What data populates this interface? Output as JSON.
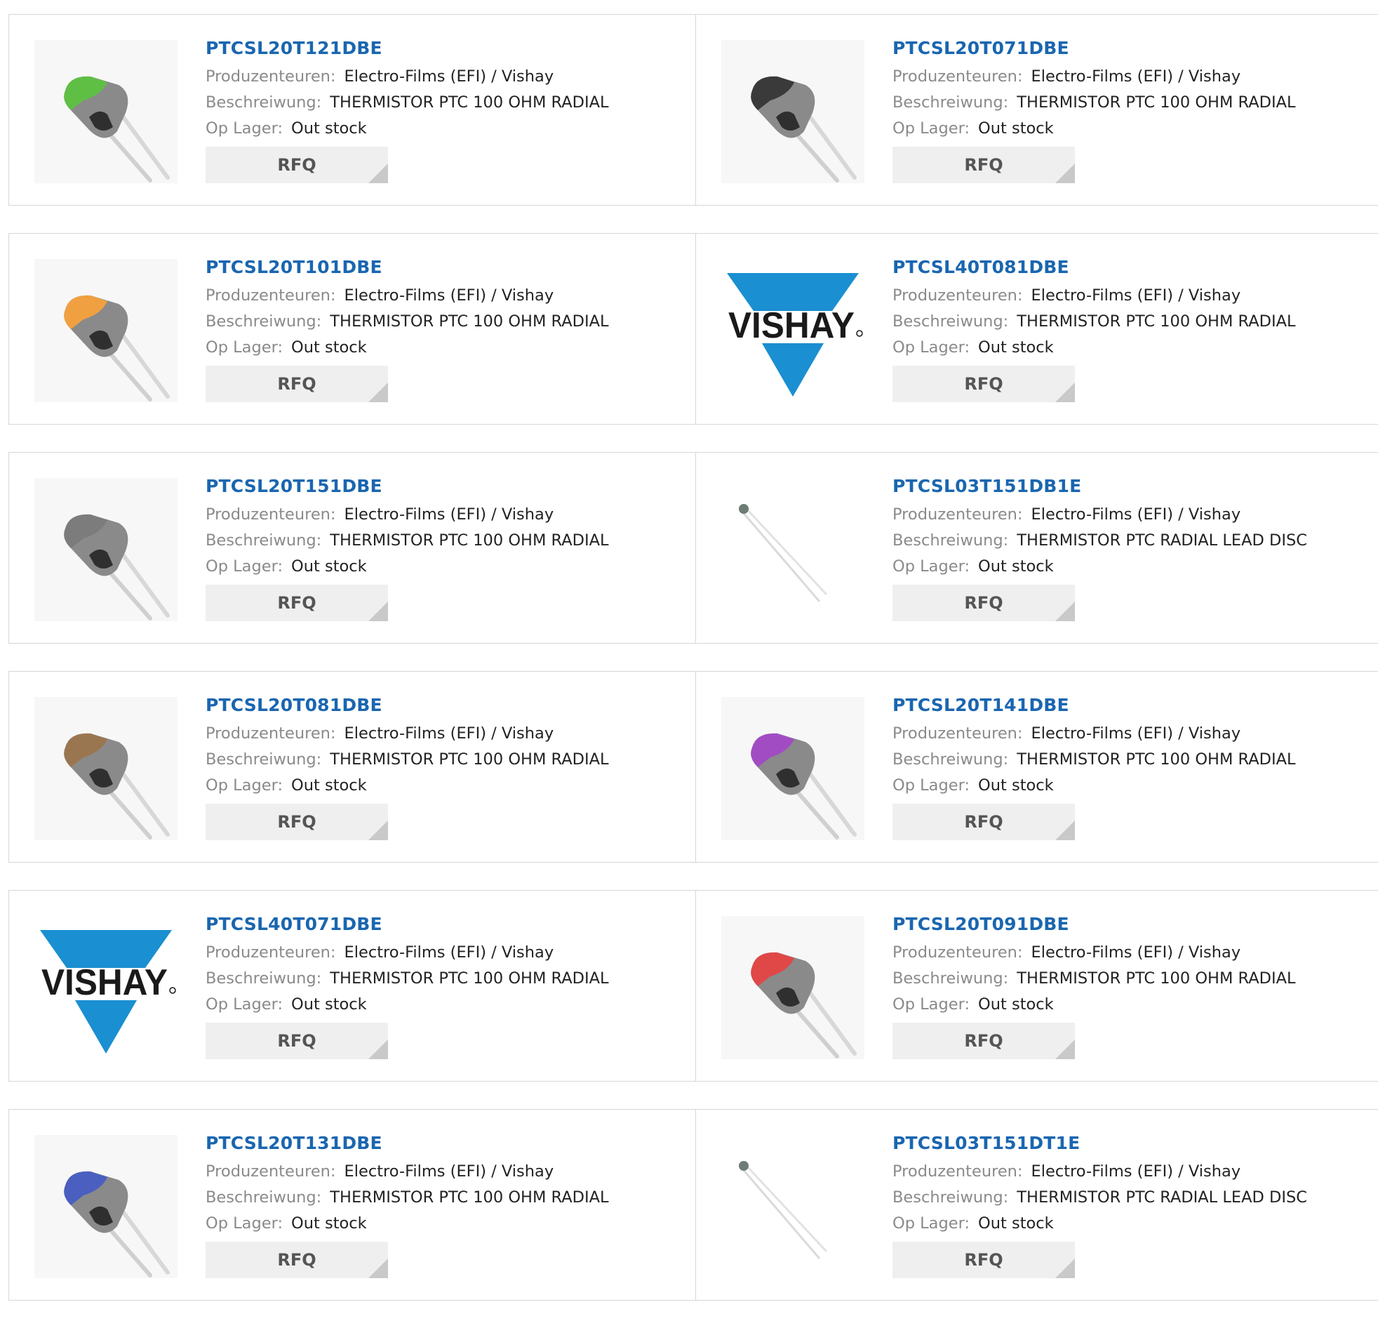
{
  "labels": {
    "manufacturer": "Produzenteuren:",
    "description": "Beschreiwung:",
    "stock": "Op Lager:",
    "rfq": "RFQ"
  },
  "products": [
    {
      "part": "PTCSL20T121DBE",
      "manufacturer": "Electro-Films (EFI) / Vishay",
      "description": "THERMISTOR PTC 100 OHM RADIAL",
      "stock": "Out stock",
      "image": "thermistor-green-icon",
      "cap_color": "#5fbf45"
    },
    {
      "part": "PTCSL20T071DBE",
      "manufacturer": "Electro-Films (EFI) / Vishay",
      "description": "THERMISTOR PTC 100 OHM RADIAL",
      "stock": "Out stock",
      "image": "thermistor-black-icon",
      "cap_color": "#3a3a3a"
    },
    {
      "part": "PTCSL20T101DBE",
      "manufacturer": "Electro-Films (EFI) / Vishay",
      "description": "THERMISTOR PTC 100 OHM RADIAL",
      "stock": "Out stock",
      "image": "thermistor-orange-icon",
      "cap_color": "#f0a040"
    },
    {
      "part": "PTCSL40T081DBE",
      "manufacturer": "Electro-Films (EFI) / Vishay",
      "description": "THERMISTOR PTC 100 OHM RADIAL",
      "stock": "Out stock",
      "image": "vishay-logo",
      "logo_text": "VISHAY"
    },
    {
      "part": "PTCSL20T151DBE",
      "manufacturer": "Electro-Films (EFI) / Vishay",
      "description": "THERMISTOR PTC 100 OHM RADIAL",
      "stock": "Out stock",
      "image": "thermistor-gray-icon",
      "cap_color": "#7c7c7c"
    },
    {
      "part": "PTCSL03T151DB1E",
      "manufacturer": "Electro-Films (EFI) / Vishay",
      "description": "THERMISTOR PTC RADIAL LEAD DISC",
      "stock": "Out stock",
      "image": "thermistor-disc-icon"
    },
    {
      "part": "PTCSL20T081DBE",
      "manufacturer": "Electro-Films (EFI) / Vishay",
      "description": "THERMISTOR PTC 100 OHM RADIAL",
      "stock": "Out stock",
      "image": "thermistor-brown-icon",
      "cap_color": "#9a7650"
    },
    {
      "part": "PTCSL20T141DBE",
      "manufacturer": "Electro-Films (EFI) / Vishay",
      "description": "THERMISTOR PTC 100 OHM RADIAL",
      "stock": "Out stock",
      "image": "thermistor-purple-icon",
      "cap_color": "#a24cc4"
    },
    {
      "part": "PTCSL40T071DBE",
      "manufacturer": "Electro-Films (EFI) / Vishay",
      "description": "THERMISTOR PTC 100 OHM RADIAL",
      "stock": "Out stock",
      "image": "vishay-logo",
      "logo_text": "VISHAY"
    },
    {
      "part": "PTCSL20T091DBE",
      "manufacturer": "Electro-Films (EFI) / Vishay",
      "description": "THERMISTOR PTC 100 OHM RADIAL",
      "stock": "Out stock",
      "image": "thermistor-red-icon",
      "cap_color": "#e04848"
    },
    {
      "part": "PTCSL20T131DBE",
      "manufacturer": "Electro-Films (EFI) / Vishay",
      "description": "THERMISTOR PTC 100 OHM RADIAL",
      "stock": "Out stock",
      "image": "thermistor-blue-icon",
      "cap_color": "#4a5fc0"
    },
    {
      "part": "PTCSL03T151DT1E",
      "manufacturer": "Electro-Films (EFI) / Vishay",
      "description": "THERMISTOR PTC RADIAL LEAD DISC",
      "stock": "Out stock",
      "image": "thermistor-disc-icon"
    }
  ],
  "colors": {
    "link": "#1a66b0",
    "vishay_blue": "#1a8fd1",
    "body_gray": "#8f8f8f",
    "lead_gray": "#d8d8d8"
  }
}
